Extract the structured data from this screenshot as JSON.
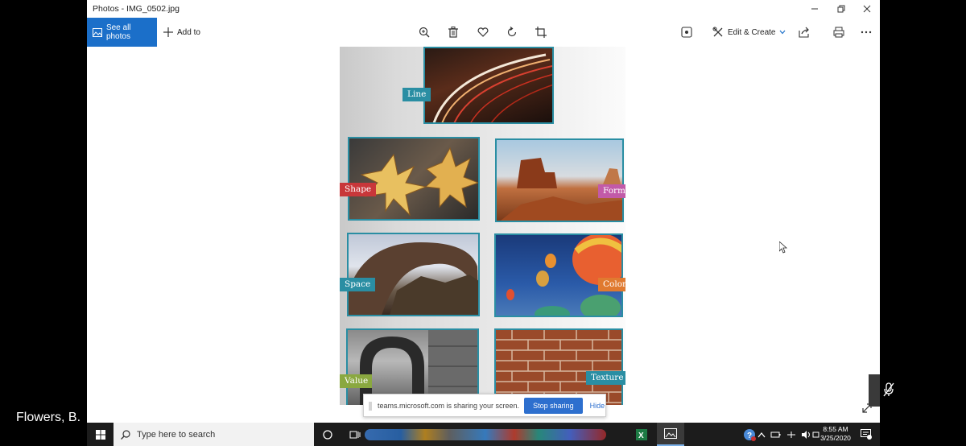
{
  "window": {
    "title": "Photos - IMG_0502.jpg"
  },
  "toolbar": {
    "see_all_label": "See all photos",
    "add_to_label": "Add to",
    "edit_create_label": "Edit & Create"
  },
  "photo_tags": {
    "line": "Line",
    "shape": "Shape",
    "form": "Form",
    "space": "Space",
    "color": "Color",
    "value": "Value",
    "texture": "Texture"
  },
  "share_bar": {
    "message": "teams.microsoft.com is sharing your screen.",
    "stop_label": "Stop sharing",
    "hide_label": "Hide"
  },
  "participant": {
    "name": "Flowers, B."
  },
  "taskbar": {
    "search_placeholder": "Type here to search",
    "time": "8:55 AM",
    "date": "3/25/2020"
  },
  "colors": {
    "accent": "#1b6fc9",
    "stop_button": "#2d6fce",
    "frame": "#2a8ea3"
  }
}
